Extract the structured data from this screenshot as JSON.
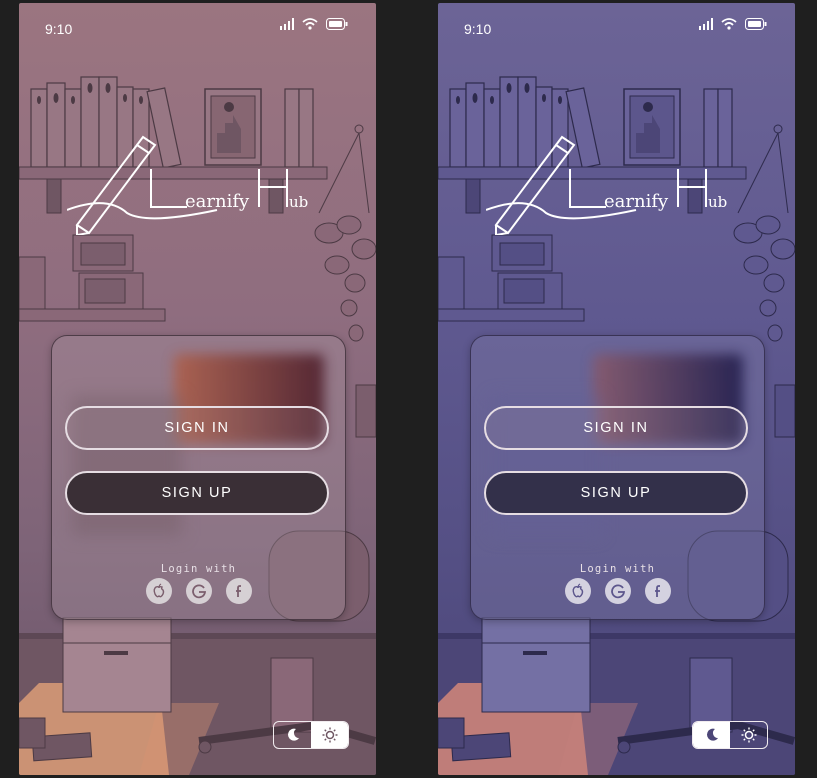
{
  "screens": [
    {
      "theme": "light",
      "status_time": "9:10",
      "app_name": "LearnifyHub",
      "sign_in_label": "SIGN IN",
      "sign_up_label": "SIGN UP",
      "login_with_label": "Login with",
      "social_providers": [
        "apple-icon",
        "google-icon",
        "facebook-icon"
      ],
      "theme_toggle": {
        "selected": "light",
        "options": [
          "moon-icon",
          "sun-icon"
        ]
      },
      "colors": {
        "background_top": "#9b7580",
        "background_bottom": "#6a5468",
        "accent_window_glow": "#f0a574"
      }
    },
    {
      "theme": "dark",
      "status_time": "9:10",
      "app_name": "LearnifyHub",
      "sign_in_label": "SIGN IN",
      "sign_up_label": "SIGN UP",
      "login_with_label": "Login with",
      "social_providers": [
        "apple-icon",
        "google-icon",
        "facebook-icon"
      ],
      "theme_toggle": {
        "selected": "dark",
        "options": [
          "moon-icon",
          "sun-icon"
        ]
      },
      "colors": {
        "background_top": "#6c6496",
        "background_bottom": "#4a4577",
        "accent_window_glow": "#e88d7c"
      }
    }
  ]
}
